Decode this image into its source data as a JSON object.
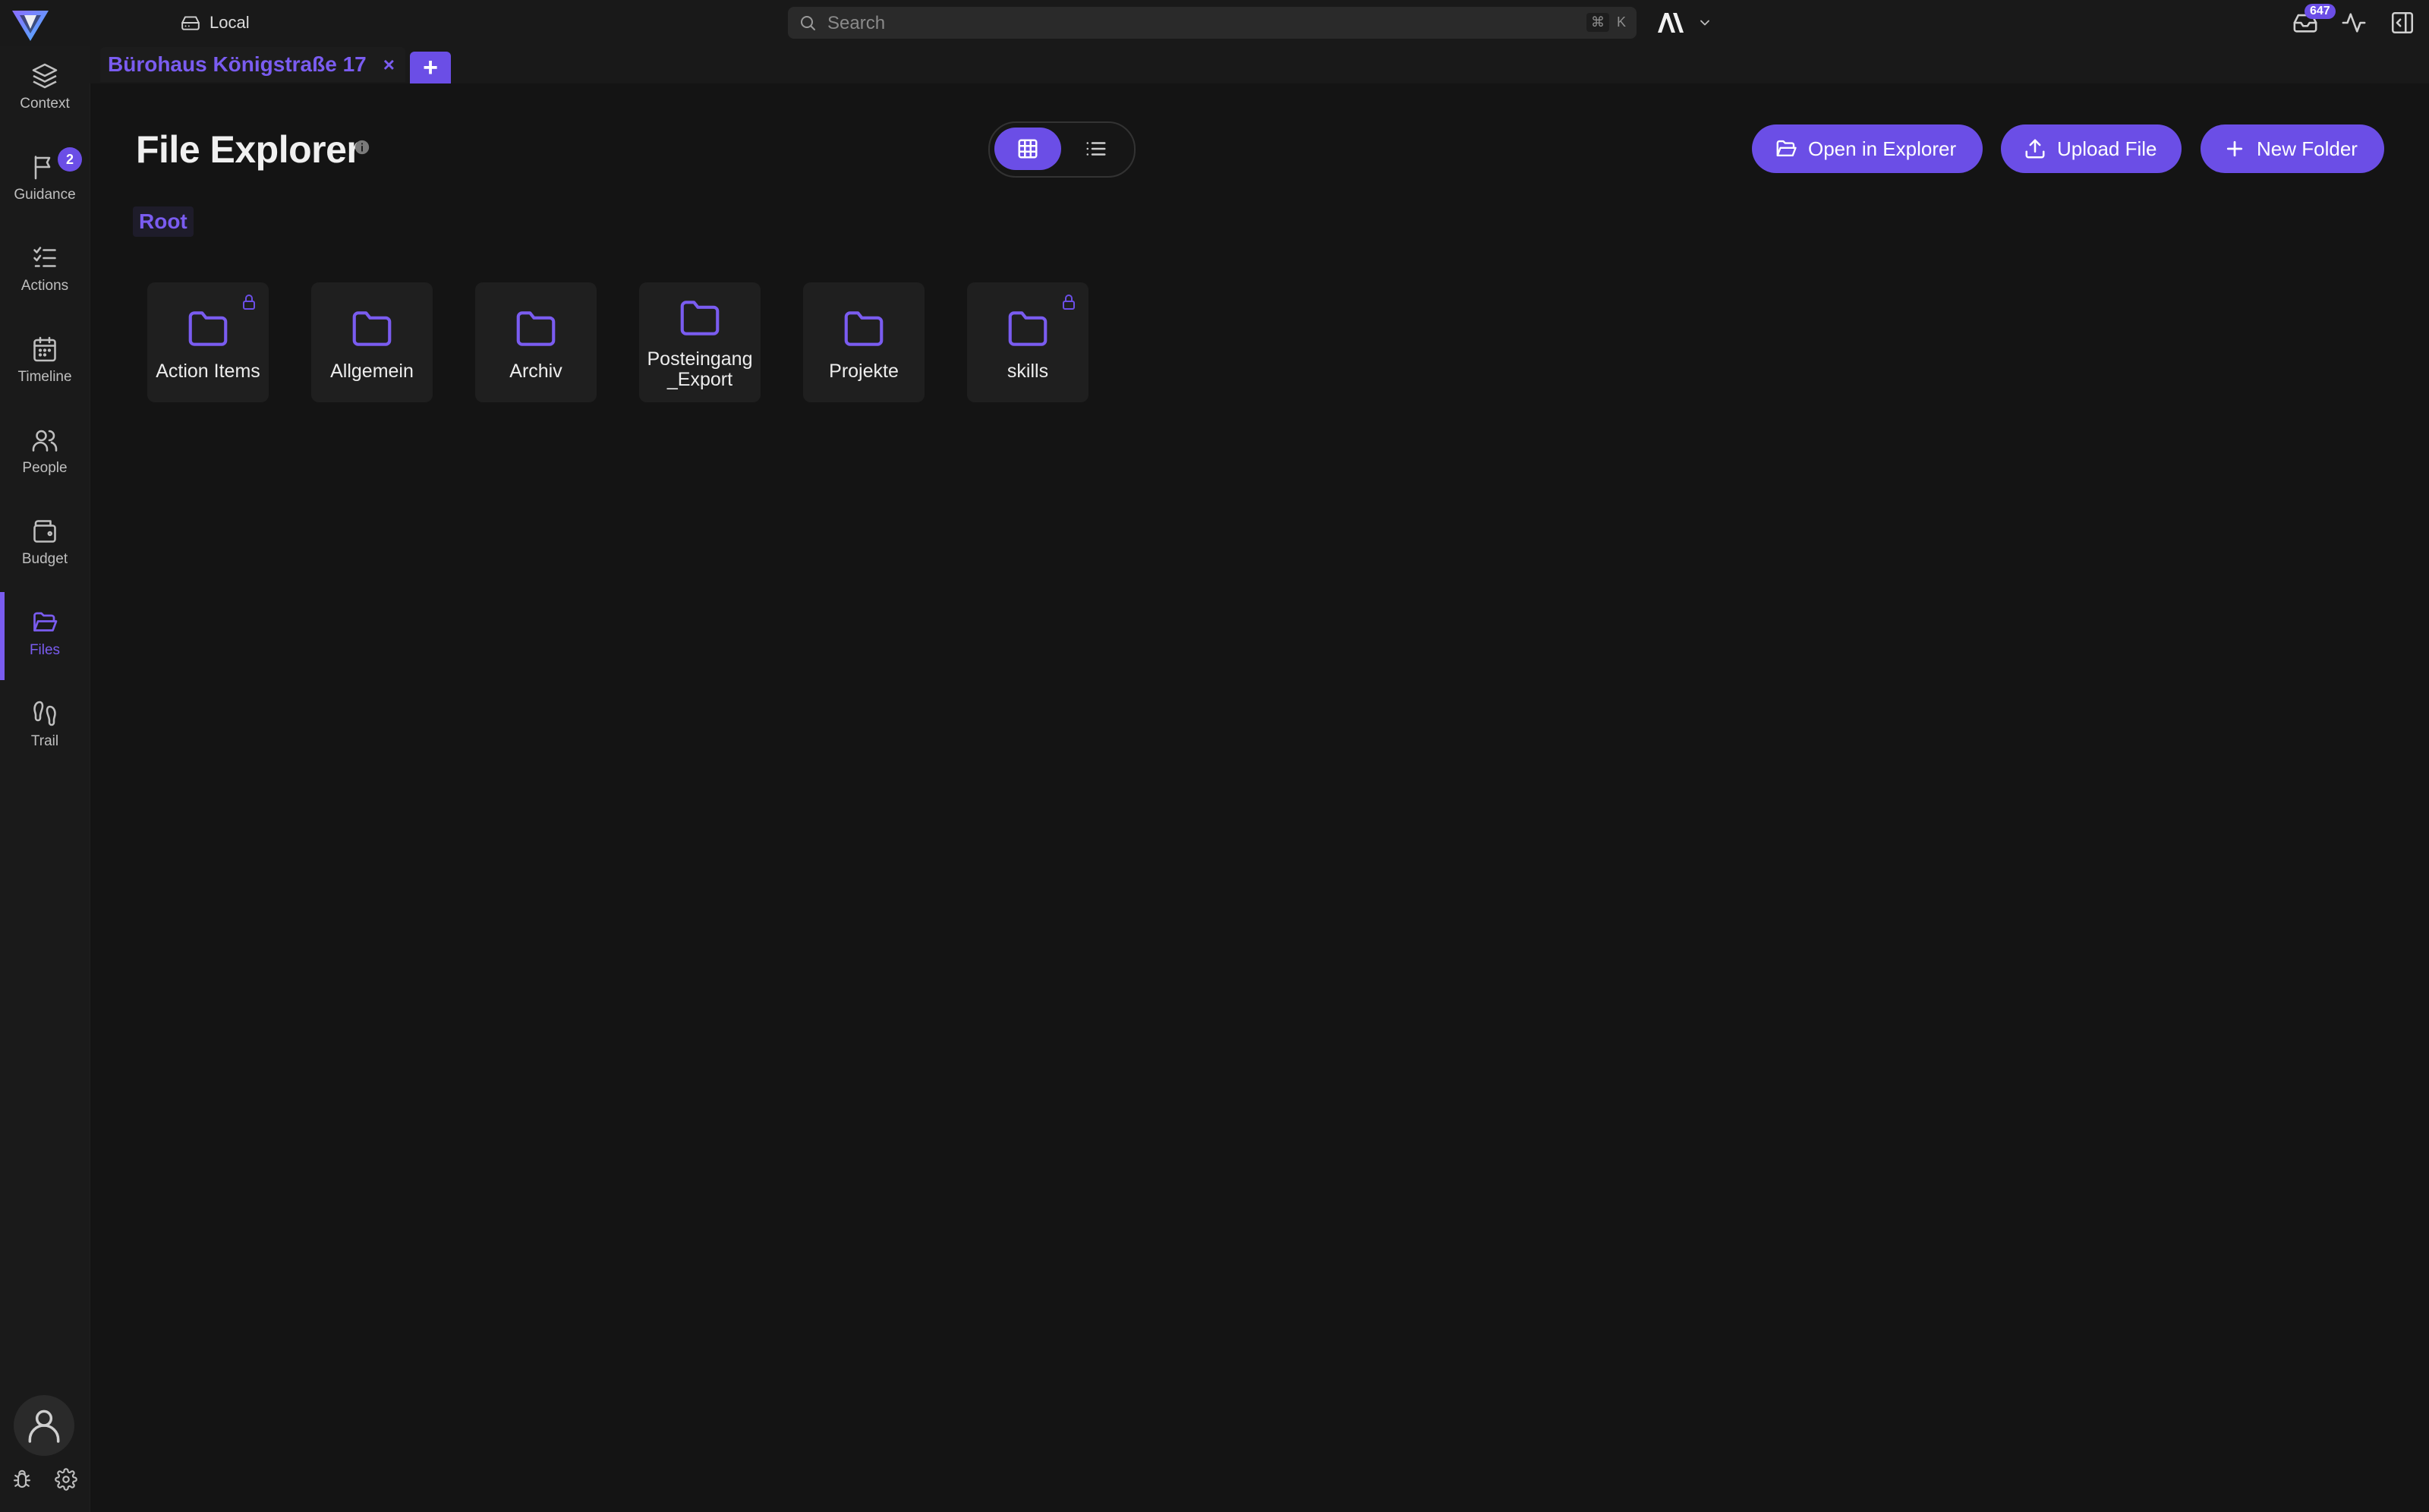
{
  "topbar": {
    "location_label": "Local",
    "search_placeholder": "Search",
    "shortcut_key_1": "⌘",
    "shortcut_key_2": "K",
    "inbox_count": "647"
  },
  "sidebar": {
    "items": [
      {
        "label": "Context",
        "icon": "layers-icon"
      },
      {
        "label": "Guidance",
        "icon": "flag-icon",
        "badge": "2"
      },
      {
        "label": "Actions",
        "icon": "checklist-icon"
      },
      {
        "label": "Timeline",
        "icon": "calendar-icon"
      },
      {
        "label": "People",
        "icon": "people-icon"
      },
      {
        "label": "Budget",
        "icon": "wallet-icon"
      },
      {
        "label": "Files",
        "icon": "folder-open-icon",
        "active": true
      },
      {
        "label": "Trail",
        "icon": "footprints-icon"
      }
    ]
  },
  "tabs": {
    "active_tab": "Bürohaus Königstraße 17",
    "close_symbol": "×",
    "add_symbol": "+"
  },
  "main": {
    "title": "File Explorer",
    "buttons": {
      "open_in_explorer": "Open in Explorer",
      "upload_file": "Upload File",
      "new_folder": "New Folder"
    },
    "breadcrumb": "Root",
    "view_mode": "grid",
    "folders": [
      {
        "name": "Action Items",
        "locked": true
      },
      {
        "name": "Allgemein",
        "locked": false
      },
      {
        "name": "Archiv",
        "locked": false
      },
      {
        "name": "Posteingang _Export",
        "locked": false
      },
      {
        "name": "Projekte",
        "locked": false
      },
      {
        "name": "skills",
        "locked": true
      }
    ]
  },
  "colors": {
    "accent": "#6b4ee6",
    "background": "#141414"
  }
}
